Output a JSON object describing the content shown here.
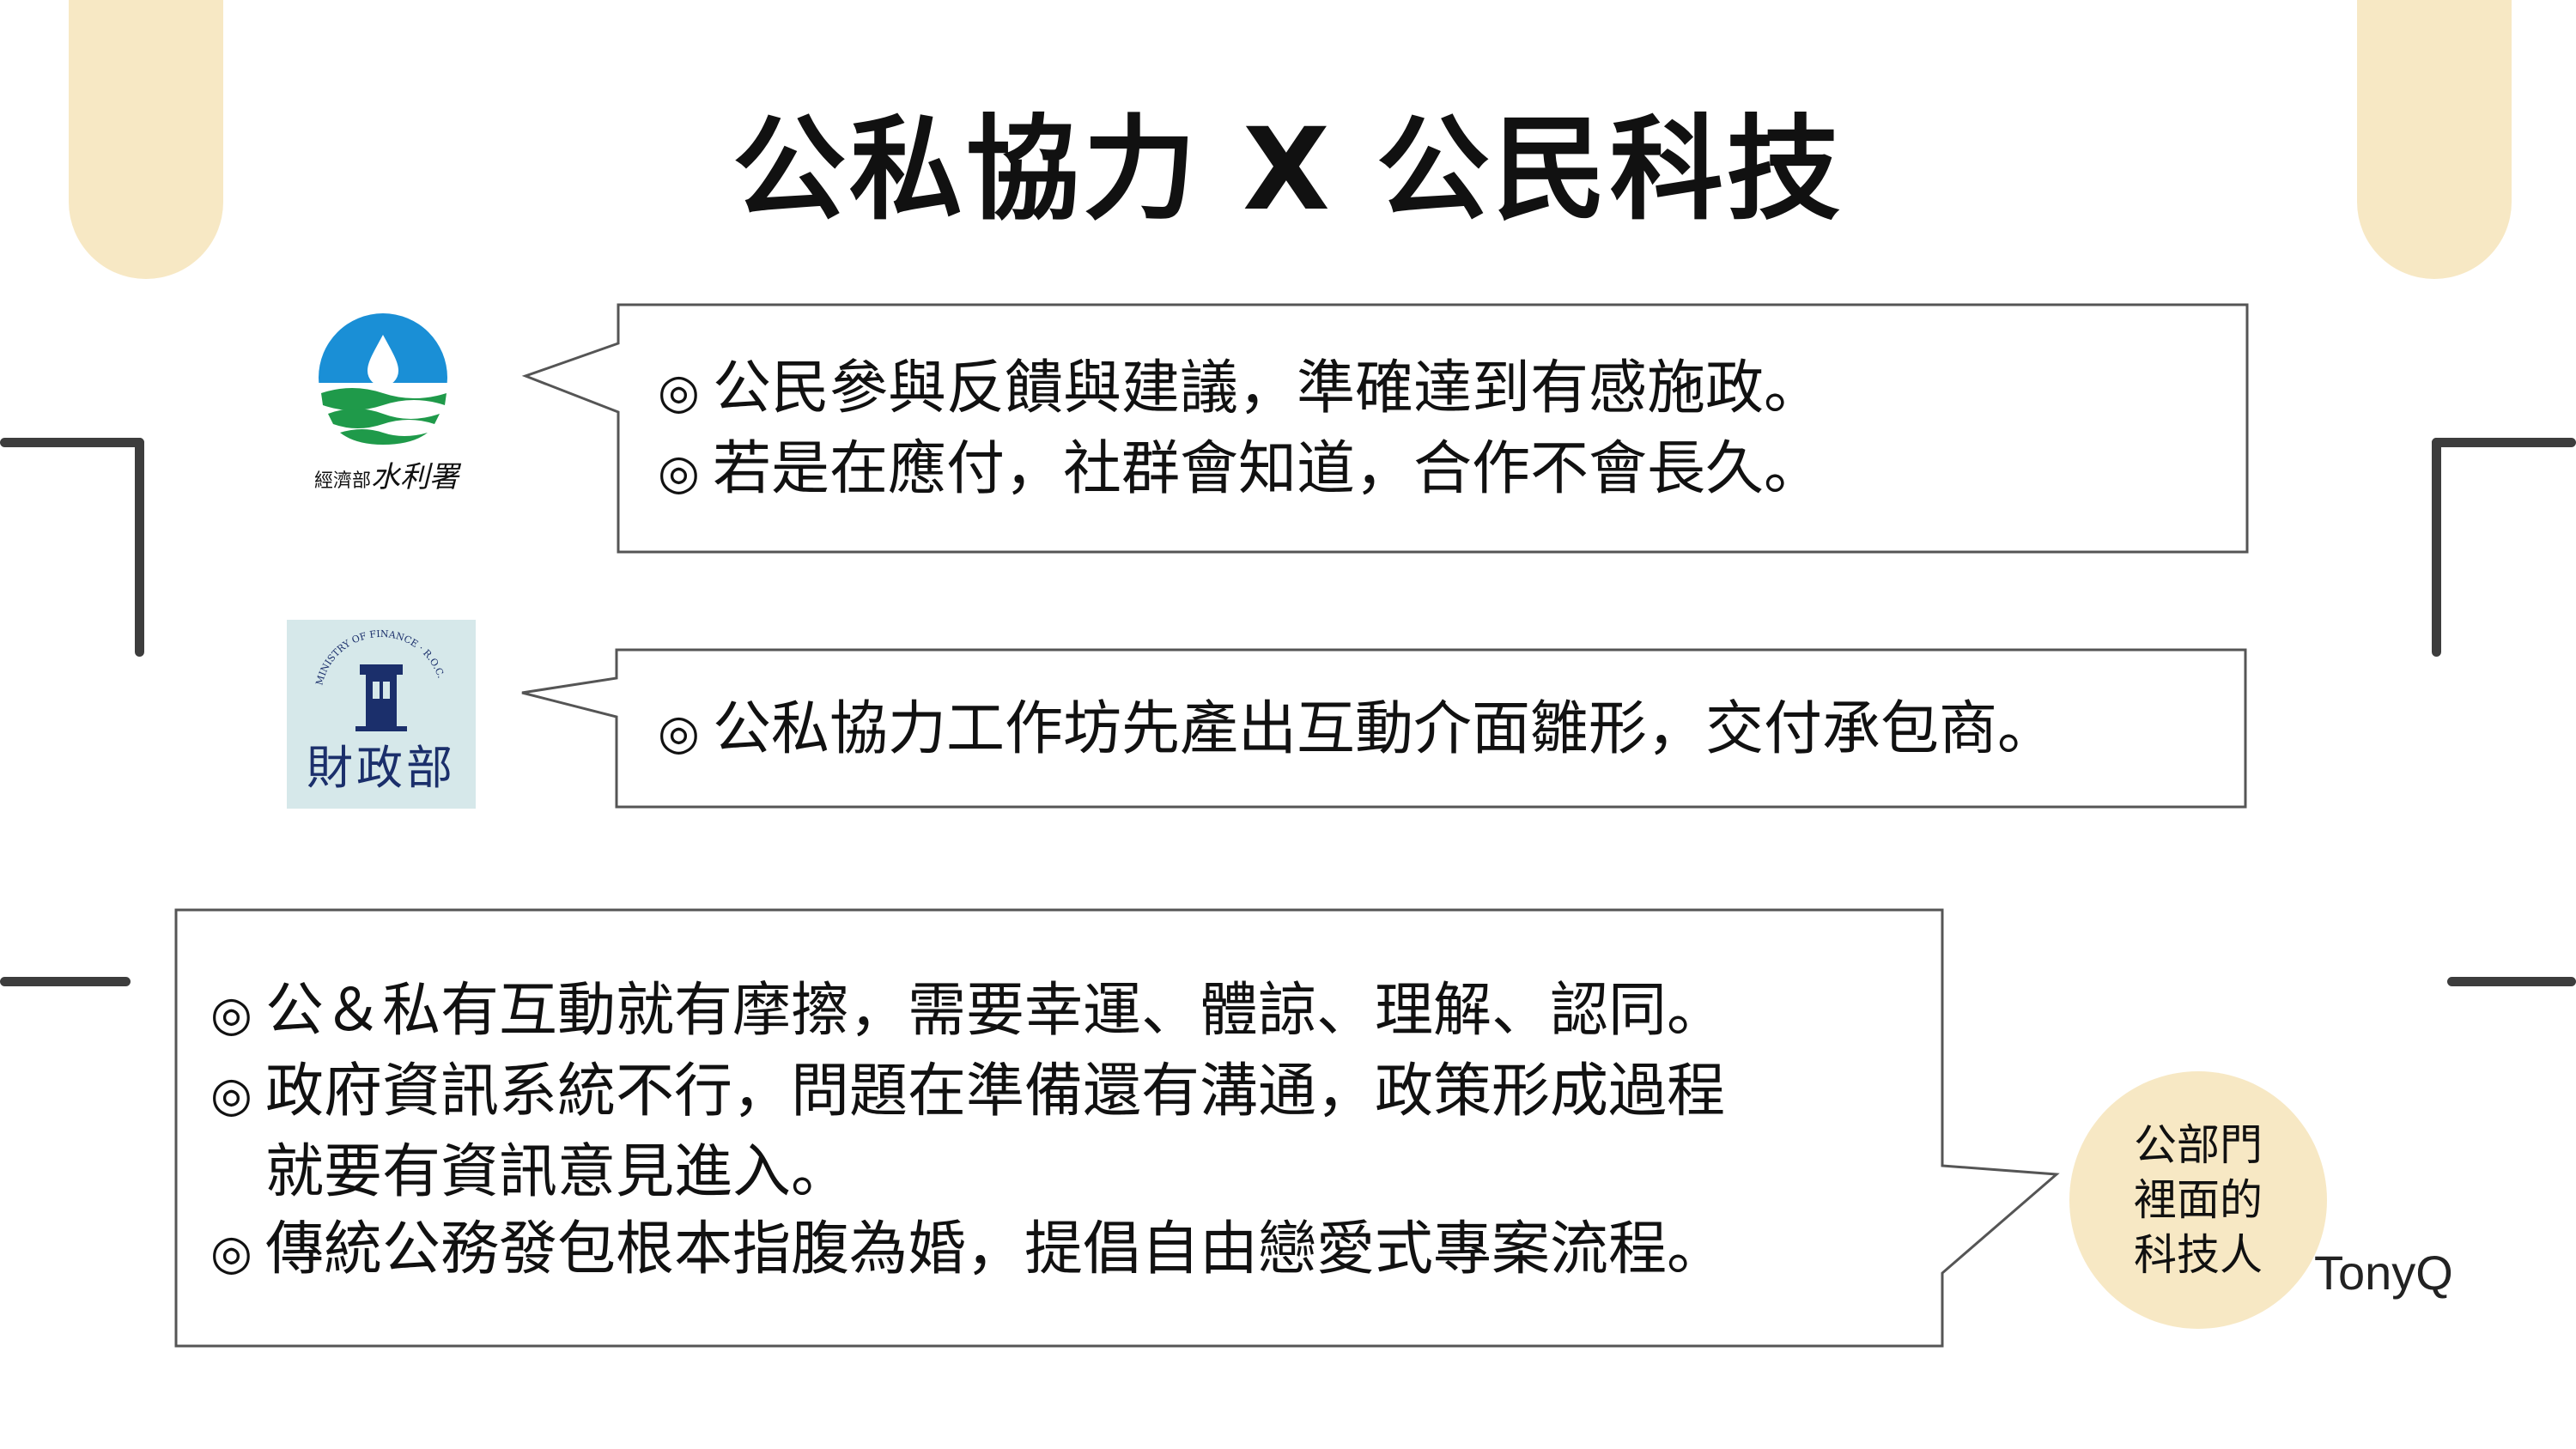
{
  "slide": {
    "title": "公私協力 X 公民科技"
  },
  "logos": {
    "wra": {
      "caption_small": "經濟部",
      "caption_brush": "水利署",
      "icon": "water-drop-logo"
    },
    "mof": {
      "arc_text": "MINISTRY OF FINANCE · R.O.C.",
      "name": "財政部",
      "icon": "ministry-of-finance-logo"
    }
  },
  "bubble1": {
    "mark": "◎",
    "lines": [
      "公民參與反饋與建議，準確達到有感施政。",
      "若是在應付，社群會知道，合作不會長久。"
    ]
  },
  "bubble2": {
    "mark": "◎",
    "lines": [
      "公私協力工作坊先產出互動介面雛形，交付承包商。"
    ]
  },
  "bubble3": {
    "mark": "◎",
    "lines": [
      "公＆私有互動就有摩擦，需要幸運、體諒、理解、認同。",
      "政府資訊系統不行，問題在準備還有溝通，政策形成過程",
      "就要有資訊意見進入。",
      "傳統公務發包根本指腹為婚，提倡自由戀愛式專案流程。"
    ]
  },
  "badge": {
    "lines": [
      "公部門",
      "裡面的",
      "科技人"
    ]
  },
  "author": "TonyQ",
  "colors": {
    "accent": "#f7e8c4",
    "frame": "#3d3d3d",
    "water_blue": "#1a8fd6",
    "water_green": "#1f9a4a"
  }
}
